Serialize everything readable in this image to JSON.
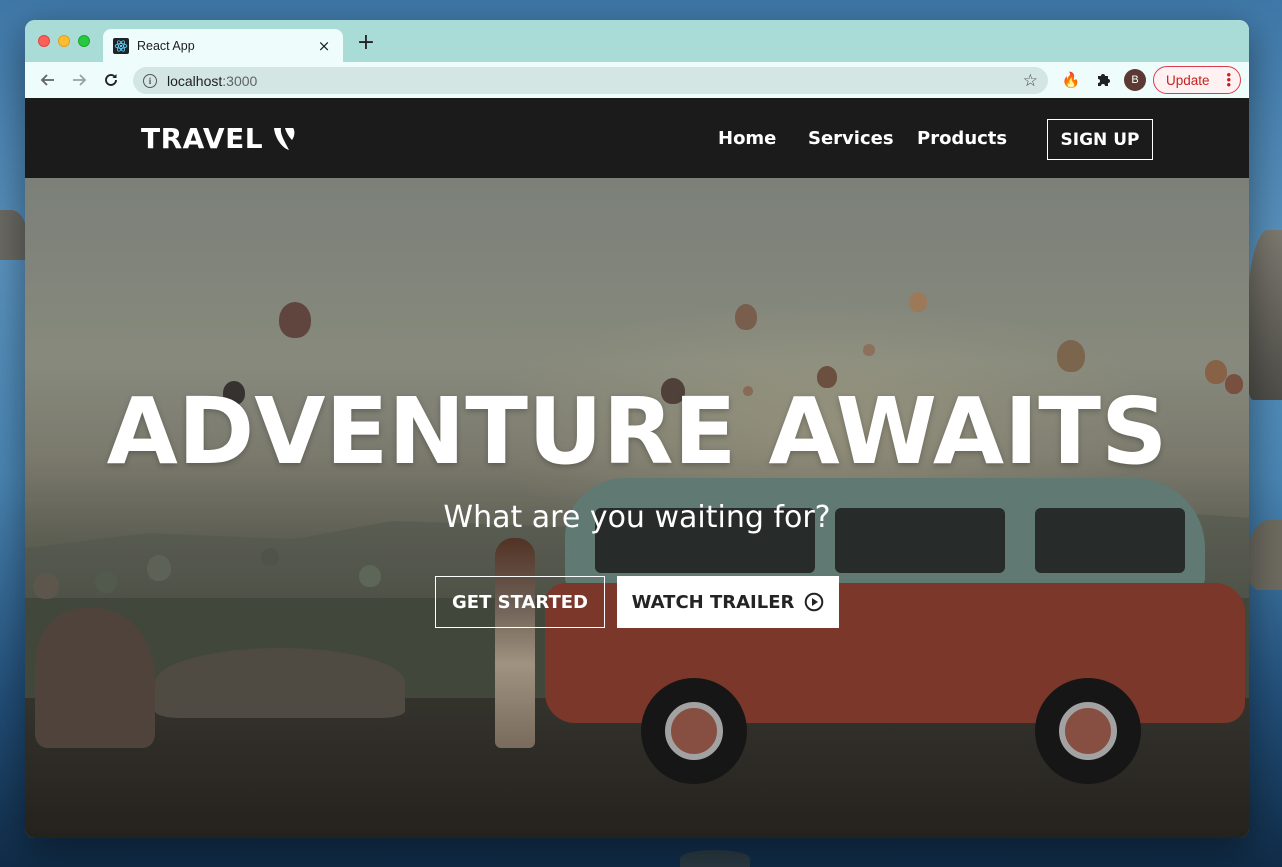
{
  "browser": {
    "tab_title": "React App",
    "tab_close": "×",
    "new_tab": "+",
    "url_host": "localhost",
    "url_port": ":3000",
    "avatar_letter": "B",
    "update_label": "Update",
    "update_menu": "⋮",
    "star": "☆",
    "flame_icon": "🔥"
  },
  "nav": {
    "logo_text": "TRAVEL",
    "links": [
      "Home",
      "Services",
      "Products"
    ],
    "signup_label": "SIGN UP"
  },
  "hero": {
    "title": "ADVENTURE AWAITS",
    "subtitle": "What are you waiting for?",
    "primary_button": "GET STARTED",
    "secondary_button": "WATCH TRAILER"
  },
  "colors": {
    "tabstrip": "#a9dcd6",
    "navbar": "#1b1b1b",
    "update_accent": "#c5221f"
  },
  "icons": {
    "back": "back-arrow-icon",
    "forward": "forward-arrow-icon",
    "reload": "reload-icon",
    "info": "info-icon",
    "star": "bookmark-star-icon",
    "extension_flame": "flame-extension-icon",
    "extensions": "puzzle-icon",
    "logo_mark": "typo3-logo-icon",
    "play": "play-circle-icon"
  }
}
